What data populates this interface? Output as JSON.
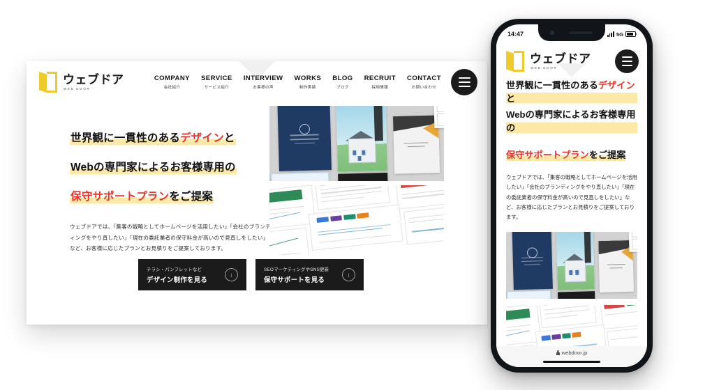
{
  "site": {
    "brand": {
      "name": "ウェブドア",
      "tagline": "WEB DOOR",
      "logo_color": "#EFCB2A"
    },
    "nav": [
      {
        "en": "COMPANY",
        "jp": "会社紹介"
      },
      {
        "en": "SERVICE",
        "jp": "サービス紹介"
      },
      {
        "en": "INTERVIEW",
        "jp": "お客様の声"
      },
      {
        "en": "WORKS",
        "jp": "制作実績"
      },
      {
        "en": "BLOG",
        "jp": "ブログ"
      },
      {
        "en": "RECRUIT",
        "jp": "採用情報"
      },
      {
        "en": "CONTACT",
        "jp": "お問い合わせ"
      }
    ],
    "menu_button": "menu",
    "hero": {
      "headline_line1_a": "世界観に一貫性のある",
      "headline_line1_accent": "デザイン",
      "headline_line1_b": "と",
      "headline_line2": "Webの専門家によるお客様専用の",
      "headline_line3_accent": "保守サポートプラン",
      "headline_line3_b": "をご提案",
      "paragraph": "ウェブドアでは、「集客の戦略としてホームページを活用したい」「会社のブランディングをやり直したい」「現在の委託業者の保守料金が高いので見直しをしたい」など、お客様に応じたプランとお見積りをご提案しております。",
      "accent_color": "#E8342B",
      "highlight_color": "#FCE9A8"
    },
    "cta_buttons": [
      {
        "small": "チラシ・パンフレットなど",
        "large": "デザイン制作を見る",
        "icon": "down-arrow-icon"
      },
      {
        "small": "SEOマーケティングやSNS更新",
        "large": "保守サポートを見る",
        "icon": "down-arrow-icon"
      }
    ],
    "images": {
      "top_alt": "print-collage",
      "bottom_alt": "analytics-dashboards"
    }
  },
  "phone": {
    "status": {
      "time": "14:47",
      "network": "5G",
      "signal_icon": "signal-bars-icon",
      "battery_icon": "battery-icon"
    },
    "browser": {
      "url": "webdoor.jp",
      "lock_icon": "lock-icon"
    }
  }
}
